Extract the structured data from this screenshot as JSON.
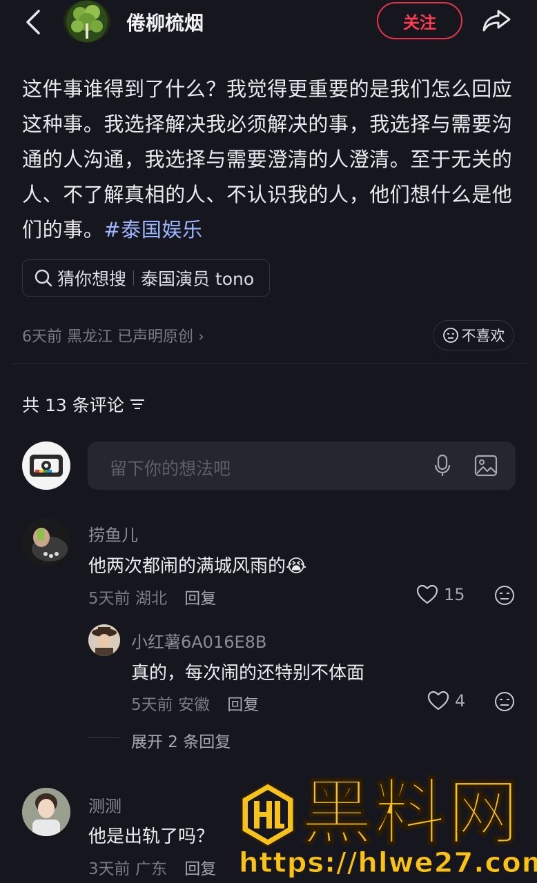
{
  "header": {
    "author_name": "倦柳梳烟",
    "follow_label": "关注"
  },
  "post": {
    "partial_line": "...",
    "text": "这件事谁得到了什么？我觉得更重要的是我们怎么回应这种事。我选择解决我必须解决的事，我选择与需要沟通的人沟通，我选择与需要澄清的人澄清。至于无关的人、不了解真相的人、不认识我的人，他们想什么是他们的事。",
    "hashtag": "#泰国娱乐",
    "search_label": "猜你想搜",
    "search_term": "泰国演员 tono",
    "meta": "6天前  黑龙江  已声明原创 ›",
    "dislike_label": "不喜欢"
  },
  "comments_section": {
    "title": "共 13 条评论",
    "input_placeholder": "留下你的想法吧"
  },
  "comments": [
    {
      "name": "捞鱼儿",
      "text": "他两次都闹的满城风雨的😭",
      "time": "5天前",
      "location": "湖北",
      "reply_label": "回复",
      "likes": "15"
    },
    {
      "name": "小红薯6A016E8B",
      "text": "真的，每次闹的还特别不体面",
      "time": "5天前",
      "location": "安徽",
      "reply_label": "回复",
      "likes": "4"
    },
    {
      "name": "测测",
      "text": "他是出轨了吗？",
      "time": "3天前",
      "location": "广东",
      "reply_label": "回复",
      "likes": ""
    }
  ],
  "expand_replies": "展开 2 条回复",
  "watermark": {
    "title": "黑料网",
    "url": "https://hlwe27.com"
  },
  "colors": {
    "background": "#16161e",
    "follow_red": "#ff3b52",
    "hashtag_blue": "#9db7ff",
    "watermark_yellow": "#f7c21a"
  }
}
